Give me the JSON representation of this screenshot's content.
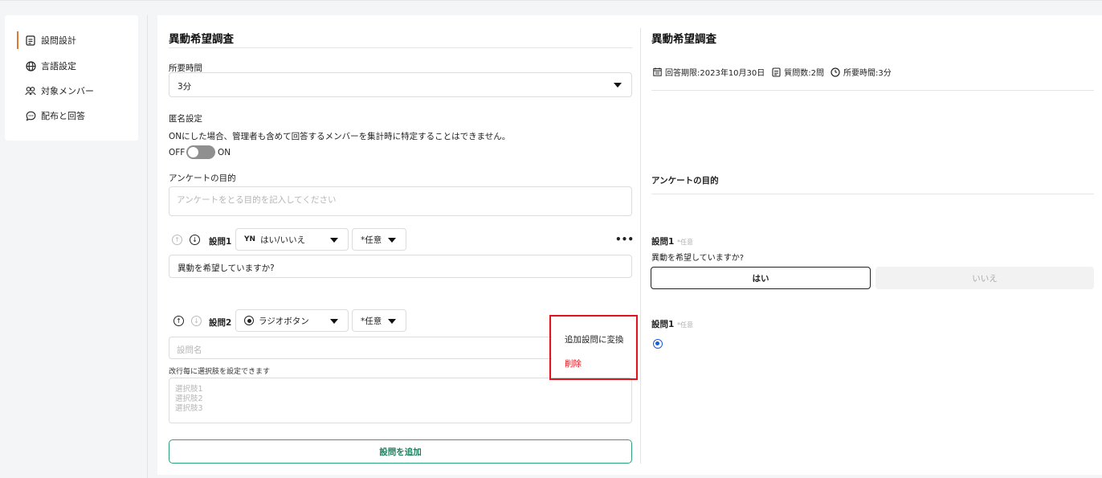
{
  "sidebar": {
    "items": [
      {
        "label": "設問設計",
        "icon": "document-icon"
      },
      {
        "label": "言語設定",
        "icon": "globe-icon"
      },
      {
        "label": "対象メンバー",
        "icon": "users-icon"
      },
      {
        "label": "配布と回答",
        "icon": "chat-icon"
      }
    ]
  },
  "editor": {
    "title": "異動希望調査",
    "duration_label": "所要時間",
    "duration_value": "3分",
    "anon_label": "匿名設定",
    "anon_desc": "ONにした場合、管理者も含めて回答するメンバーを集計時に特定することはできません。",
    "toggle_off": "OFF",
    "toggle_on": "ON",
    "purpose_label": "アンケートの目的",
    "purpose_placeholder": "アンケートをとる目的を記入してください",
    "q1": {
      "label": "設問1",
      "type": "はい/いいえ",
      "type_icon": "YN",
      "required": "*任意",
      "text": "異動を希望していますか?"
    },
    "q2": {
      "label": "設問2",
      "type": "ラジオボタン",
      "required": "*任意",
      "name_placeholder": "設問名",
      "choices_hint": "改行毎に選択肢を設定できます",
      "choices_placeholder": [
        "選択肢1",
        "選択肢2",
        "選択肢3"
      ]
    },
    "menu": {
      "convert": "追加設問に変換",
      "delete": "削除"
    },
    "add_button": "設問を追加",
    "more": "•••"
  },
  "preview": {
    "title": "異動希望調査",
    "deadline": "回答期限:2023年10月30日",
    "count": "質問数:2問",
    "time": "所要時間:3分",
    "purpose_label": "アンケートの目的",
    "q1_label": "設問1",
    "q1_tag": "*任意",
    "q1_text": "異動を希望していますか?",
    "yes": "はい",
    "no": "いいえ",
    "q2_label": "設問1",
    "q2_tag": "*任意"
  },
  "colors": {
    "accent": "#e4752f",
    "highlight": "#e0141e",
    "add_button": "#2aa37a",
    "radio": "#1a5ddb"
  }
}
